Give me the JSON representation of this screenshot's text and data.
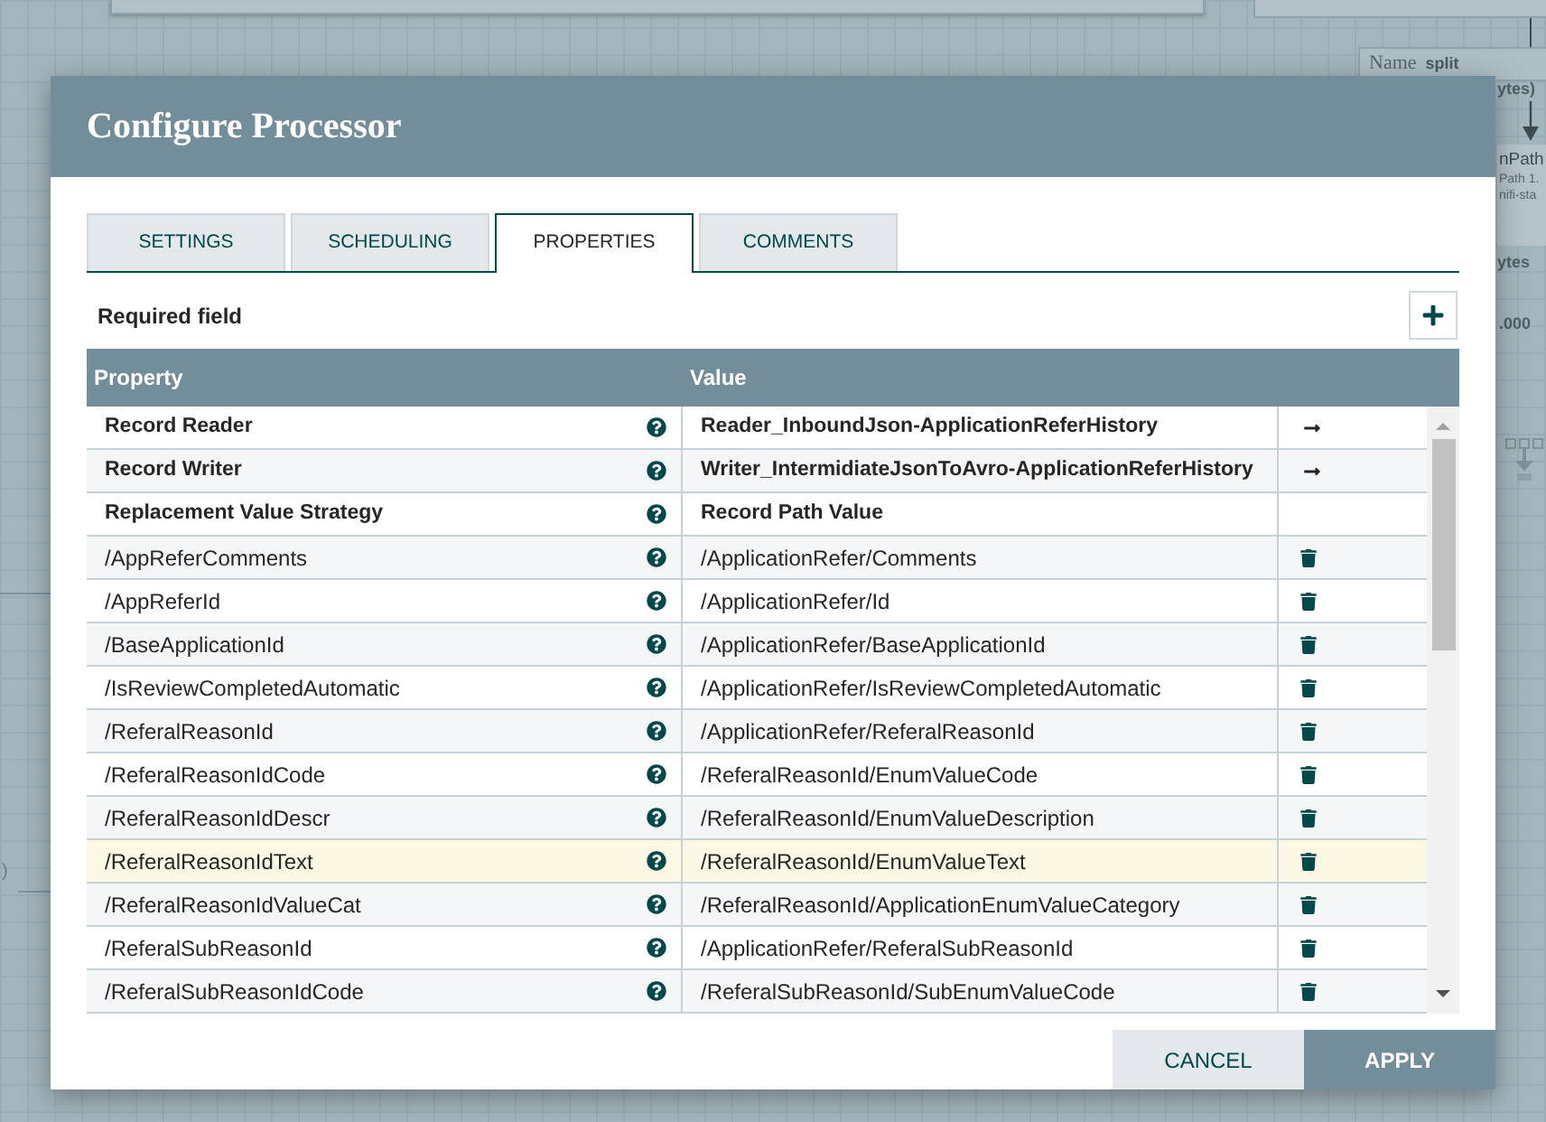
{
  "background": {
    "name_box": {
      "label": "Name",
      "value": "split"
    },
    "stat_labels": [
      "ytes)",
      "ytes",
      ".000"
    ],
    "processor": {
      "name": "nPath",
      "type": "Path 1.",
      "bundle": "nifi-sta"
    },
    "edge_label": ")"
  },
  "dialog": {
    "title": "Configure Processor",
    "tabs": [
      {
        "label": "SETTINGS",
        "selected": false
      },
      {
        "label": "SCHEDULING",
        "selected": false
      },
      {
        "label": "PROPERTIES",
        "selected": true
      },
      {
        "label": "COMMENTS",
        "selected": false
      }
    ],
    "required_label": "Required field",
    "table": {
      "columns": [
        "Property",
        "Value"
      ],
      "rows": [
        {
          "kind": "service",
          "property": "Record Reader",
          "value": "Reader_InboundJson-ApplicationReferHistory",
          "required": true,
          "selected": false
        },
        {
          "kind": "service",
          "property": "Record Writer",
          "value": "Writer_IntermidiateJsonToAvro-ApplicationReferHistory",
          "required": true,
          "selected": false
        },
        {
          "kind": "fixed",
          "property": "Replacement Value Strategy",
          "value": "Record Path Value",
          "required": true,
          "selected": false
        },
        {
          "kind": "dynamic",
          "property": "/AppReferComments",
          "value": "/ApplicationRefer/Comments",
          "required": false,
          "selected": false
        },
        {
          "kind": "dynamic",
          "property": "/AppReferId",
          "value": "/ApplicationRefer/Id",
          "required": false,
          "selected": false
        },
        {
          "kind": "dynamic",
          "property": "/BaseApplicationId",
          "value": "/ApplicationRefer/BaseApplicationId",
          "required": false,
          "selected": false
        },
        {
          "kind": "dynamic",
          "property": "/IsReviewCompletedAutomatic",
          "value": "/ApplicationRefer/IsReviewCompletedAutomatic",
          "required": false,
          "selected": false
        },
        {
          "kind": "dynamic",
          "property": "/ReferalReasonId",
          "value": "/ApplicationRefer/ReferalReasonId",
          "required": false,
          "selected": false
        },
        {
          "kind": "dynamic",
          "property": "/ReferalReasonIdCode",
          "value": "/ReferalReasonId/EnumValueCode",
          "required": false,
          "selected": false
        },
        {
          "kind": "dynamic",
          "property": "/ReferalReasonIdDescr",
          "value": "/ReferalReasonId/EnumValueDescription",
          "required": false,
          "selected": false
        },
        {
          "kind": "dynamic",
          "property": "/ReferalReasonIdText",
          "value": "/ReferalReasonId/EnumValueText",
          "required": false,
          "selected": true
        },
        {
          "kind": "dynamic",
          "property": "/ReferalReasonIdValueCat",
          "value": "/ReferalReasonId/ApplicationEnumValueCategory",
          "required": false,
          "selected": false
        },
        {
          "kind": "dynamic",
          "property": "/ReferalSubReasonId",
          "value": "/ApplicationRefer/ReferalSubReasonId",
          "required": false,
          "selected": false
        },
        {
          "kind": "dynamic",
          "property": "/ReferalSubReasonIdCode",
          "value": "/ReferalSubReasonId/SubEnumValueCode",
          "required": false,
          "selected": false
        }
      ]
    },
    "buttons": [
      {
        "label": "CANCEL",
        "kind": "secondary"
      },
      {
        "label": "APPLY",
        "kind": "primary"
      }
    ]
  }
}
